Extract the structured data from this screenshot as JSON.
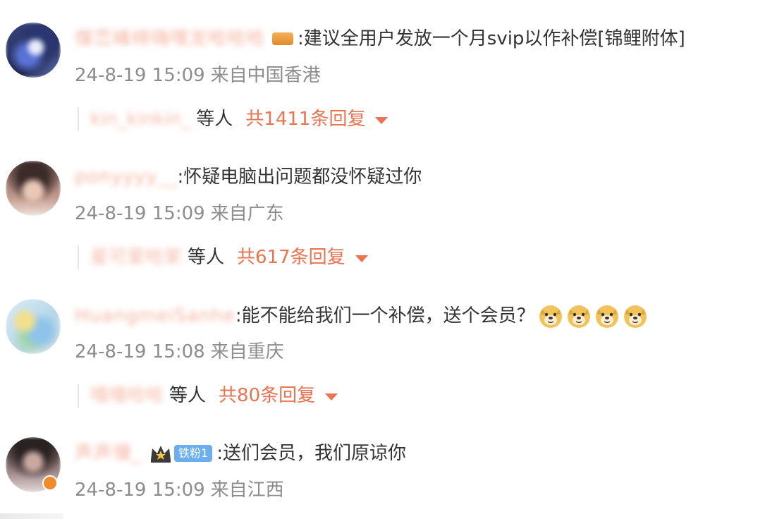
{
  "comments": [
    {
      "username": "傑峦峰缔嗨嘿龙哈哈哈",
      "text": ":建议全用户发放一个月svip以作补偿[锦鲤附体]",
      "date": "24-8-19 15:09",
      "location": "来自中国香港",
      "reply_user": "kin_kinkin_",
      "reply_sep": "等人",
      "reply_count": "共1411条回复"
    },
    {
      "username": "ponyyyy__",
      "text": ":怀疑电脑出问题都没怀疑过你",
      "date": "24-8-19 15:09",
      "location": "来自广东",
      "reply_user": "星可爱哈家",
      "reply_sep": "等人",
      "reply_count": "共617条回复"
    },
    {
      "username": "HuangmeiSanhe",
      "text": ":能不能给我们一个补偿，送个会员？",
      "date": "24-8-19 15:08",
      "location": "来自重庆",
      "reply_user": "嘻嘻哈哈",
      "reply_sep": "等人",
      "reply_count": "共80条回复"
    },
    {
      "username": "声声慢_",
      "badge": "铁粉1",
      "text": ":送们会员，我们原谅你",
      "date": "24-8-19 15:09",
      "location": "来自江西"
    }
  ],
  "icons": {
    "dropdown": "chevron-down-icon",
    "doge": "doge-emoji-icon",
    "crown": "crown-icon"
  },
  "colors": {
    "accent": "#eb7350",
    "meta": "#8c8c8c",
    "fan_badge": "#6aaef0"
  }
}
